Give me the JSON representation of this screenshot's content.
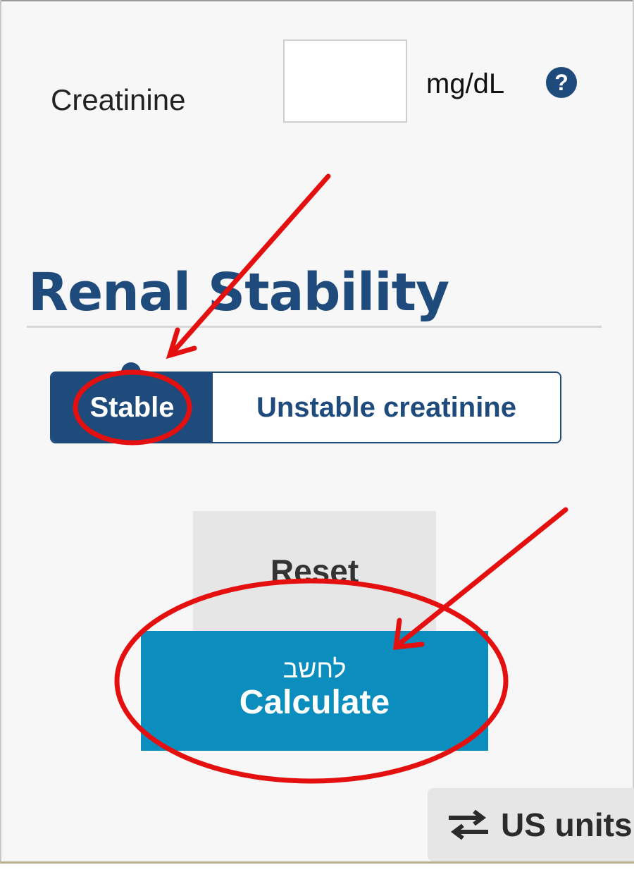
{
  "creatinine": {
    "label": "Creatinine",
    "value": "",
    "unit": "mg/dL",
    "help_icon": "question-circle-icon",
    "help_glyph": "?"
  },
  "renal_stability": {
    "title": "Renal Stability",
    "options": [
      "Stable",
      "Unstable creatinine"
    ],
    "selected": "Stable"
  },
  "actions": {
    "reset_label": "Reset",
    "calculate_hebrew": "לחשב",
    "calculate_label": "Calculate"
  },
  "units": {
    "label": "US units",
    "icon": "swap-arrows-icon"
  },
  "colors": {
    "primary": "#1f4a7c",
    "calculate": "#0b8dbe",
    "annotation": "#e41010"
  }
}
